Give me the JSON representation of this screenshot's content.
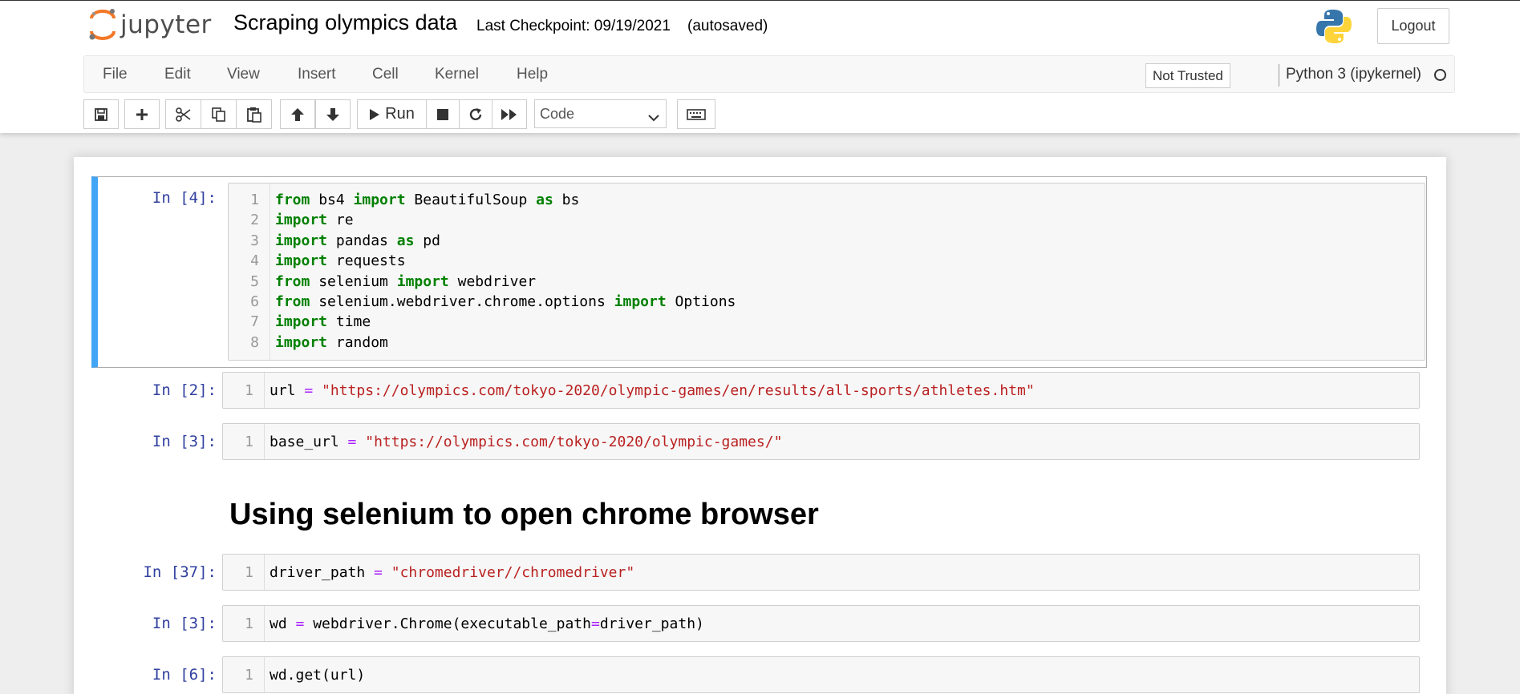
{
  "header": {
    "logo_text": "jupyter",
    "notebook_title": "Scraping olympics data",
    "checkpoint": "Last Checkpoint: 09/19/2021",
    "autosave_status": "(autosaved)",
    "logout_label": "Logout"
  },
  "menubar": {
    "items": [
      "File",
      "Edit",
      "View",
      "Insert",
      "Cell",
      "Kernel",
      "Help"
    ],
    "trust_status": "Not Trusted",
    "kernel_name": "Python 3 (ipykernel)"
  },
  "toolbar": {
    "run_label": "Run",
    "cell_type": "Code",
    "icons": [
      "save-icon",
      "plus-icon",
      "scissors-icon",
      "copy-icon",
      "paste-icon",
      "arrow-up-icon",
      "arrow-down-icon",
      "play-icon",
      "stop-icon",
      "restart-icon",
      "fast-forward-icon",
      "keyboard-icon"
    ]
  },
  "colors": {
    "selected_cell_bar": "#42a5f5",
    "prompt": "#303f9f",
    "keyword": "#008000",
    "operator": "#aa22ff",
    "string": "#ba2121"
  },
  "cells": [
    {
      "prompt": "In [4]:",
      "lines": [
        {
          "n": "1",
          "tokens": [
            [
              "kw",
              "from"
            ],
            [
              "t",
              " bs4 "
            ],
            [
              "kw",
              "import"
            ],
            [
              "t",
              " BeautifulSoup "
            ],
            [
              "kw",
              "as"
            ],
            [
              "t",
              " bs"
            ]
          ]
        },
        {
          "n": "2",
          "tokens": [
            [
              "kw",
              "import"
            ],
            [
              "t",
              " re"
            ]
          ]
        },
        {
          "n": "3",
          "tokens": [
            [
              "kw",
              "import"
            ],
            [
              "t",
              " pandas "
            ],
            [
              "kw",
              "as"
            ],
            [
              "t",
              " pd"
            ]
          ]
        },
        {
          "n": "4",
          "tokens": [
            [
              "kw",
              "import"
            ],
            [
              "t",
              " requests"
            ]
          ]
        },
        {
          "n": "5",
          "tokens": [
            [
              "kw",
              "from"
            ],
            [
              "t",
              " selenium "
            ],
            [
              "kw",
              "import"
            ],
            [
              "t",
              " webdriver"
            ]
          ]
        },
        {
          "n": "6",
          "tokens": [
            [
              "kw",
              "from"
            ],
            [
              "t",
              " selenium.webdriver.chrome.options "
            ],
            [
              "kw",
              "import"
            ],
            [
              "t",
              " Options"
            ]
          ]
        },
        {
          "n": "7",
          "tokens": [
            [
              "kw",
              "import"
            ],
            [
              "t",
              " time"
            ]
          ]
        },
        {
          "n": "8",
          "tokens": [
            [
              "kw",
              "import"
            ],
            [
              "t",
              " random"
            ]
          ]
        }
      ]
    },
    {
      "prompt": "In [2]:",
      "lines": [
        {
          "n": "1",
          "tokens": [
            [
              "t",
              "url "
            ],
            [
              "op",
              "="
            ],
            [
              "t",
              " "
            ],
            [
              "str",
              "\"https://olympics.com/tokyo-2020/olympic-games/en/results/all-sports/athletes.htm\""
            ]
          ]
        }
      ]
    },
    {
      "prompt": "In [3]:",
      "lines": [
        {
          "n": "1",
          "tokens": [
            [
              "t",
              "base_url "
            ],
            [
              "op",
              "="
            ],
            [
              "t",
              " "
            ],
            [
              "str",
              "\"https://olympics.com/tokyo-2020/olympic-games/\""
            ]
          ]
        }
      ]
    },
    {
      "prompt": "In [37]:",
      "lines": [
        {
          "n": "1",
          "tokens": [
            [
              "t",
              "driver_path "
            ],
            [
              "op",
              "="
            ],
            [
              "t",
              " "
            ],
            [
              "str",
              "\"chromedriver//chromedriver\""
            ]
          ]
        }
      ]
    },
    {
      "prompt": "In [3]:",
      "lines": [
        {
          "n": "1",
          "tokens": [
            [
              "t",
              "wd "
            ],
            [
              "op",
              "="
            ],
            [
              "t",
              " webdriver.Chrome(executable_path"
            ],
            [
              "op",
              "="
            ],
            [
              "t",
              "driver_path)"
            ]
          ]
        }
      ]
    },
    {
      "prompt": "In [6]:",
      "lines": [
        {
          "n": "1",
          "tokens": [
            [
              "t",
              "wd.get(url)"
            ]
          ]
        }
      ]
    }
  ],
  "markdown": {
    "heading": "Using selenium to open chrome browser"
  }
}
